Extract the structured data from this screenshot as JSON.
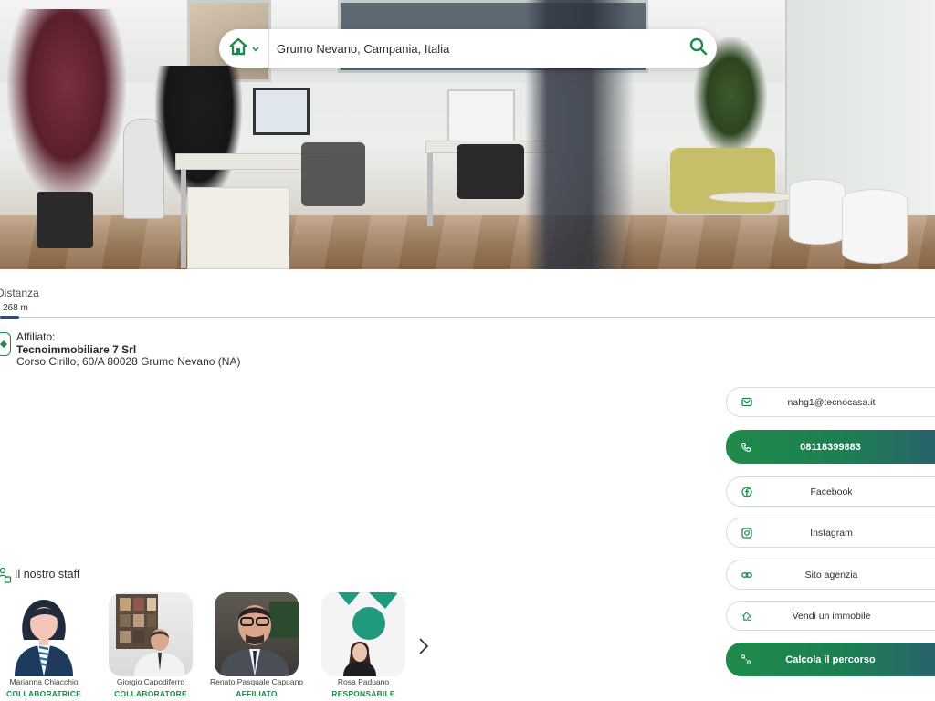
{
  "search": {
    "property_type_icon": "home-icon",
    "location_value": "Grumo Nevano, Campania, Italia",
    "search_icon": "search-icon"
  },
  "distance": {
    "label": "Distanza",
    "value": "268 m",
    "level_fraction": 0.02
  },
  "affiliate": {
    "label": "Affiliato:",
    "name": "Tecnoimmobiliare 7 Srl",
    "address": "Corso Cirillo, 60/A 80028 Grumo Nevano (NA)"
  },
  "contacts": {
    "email": {
      "label": "nahg1@tecnocasa.it",
      "icon": "mail-icon"
    },
    "phone": {
      "label": "08118399883",
      "icon": "phone-icon"
    },
    "facebook": {
      "label": "Facebook",
      "icon": "facebook-icon"
    },
    "instagram": {
      "label": "Instagram",
      "icon": "instagram-icon"
    },
    "website": {
      "label": "Sito agenzia",
      "icon": "link-icon"
    },
    "sell": {
      "label": "Vendi un immobile",
      "icon": "home-sell-icon"
    },
    "route": {
      "label": "Calcola il percorso",
      "icon": "route-icon"
    }
  },
  "staff": {
    "title": "Il nostro staff",
    "members": [
      {
        "name": "Marianna Chiacchio",
        "role": "COLLABORATRICE"
      },
      {
        "name": "Giorgio Capodiferro",
        "role": "COLLABORATORE"
      },
      {
        "name": "Renato Pasquale Capuano",
        "role": "AFFILIATO"
      },
      {
        "name": "Rosa Paduano",
        "role": "RESPONSABILE"
      }
    ]
  },
  "colors": {
    "brand_green": "#1f8a4c",
    "brand_blue": "#2b5f6f",
    "progress": "#2c4f79"
  }
}
